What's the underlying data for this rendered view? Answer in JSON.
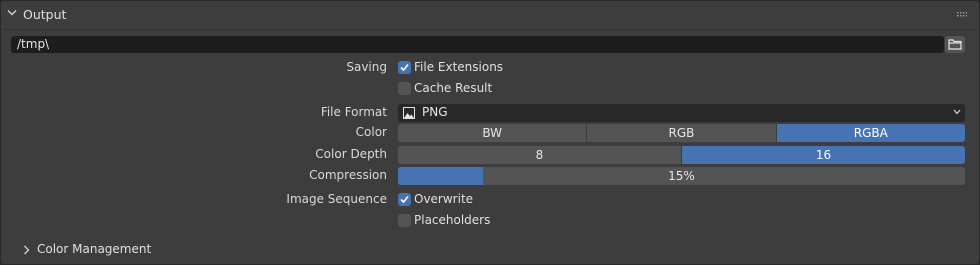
{
  "panel": {
    "title": "Output"
  },
  "output_path": {
    "value": "/tmp\\"
  },
  "saving": {
    "label": "Saving",
    "file_extensions": {
      "label": "File Extensions",
      "checked": true
    },
    "cache_result": {
      "label": "Cache Result",
      "checked": false
    }
  },
  "file_format": {
    "label": "File Format",
    "value": "PNG"
  },
  "color": {
    "label": "Color",
    "options": [
      "BW",
      "RGB",
      "RGBA"
    ],
    "selected": "RGBA"
  },
  "color_depth": {
    "label": "Color Depth",
    "options": [
      "8",
      "16"
    ],
    "selected": "16"
  },
  "compression": {
    "label": "Compression",
    "value_text": "15%",
    "value": 0.15
  },
  "image_sequence": {
    "label": "Image Sequence",
    "overwrite": {
      "label": "Overwrite",
      "checked": true
    },
    "placeholders": {
      "label": "Placeholders",
      "checked": false
    }
  },
  "color_management": {
    "title": "Color Management"
  },
  "colors": {
    "accent": "#4772b3",
    "panel": "#3d3d3d",
    "widget": "#545454"
  }
}
